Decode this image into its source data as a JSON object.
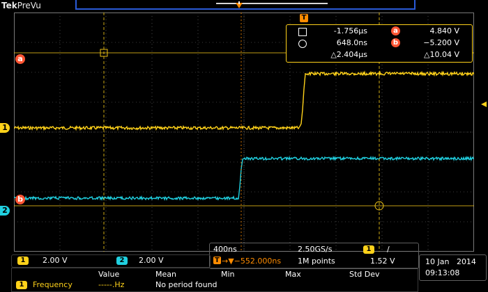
{
  "header": {
    "brand_bold": "Tek",
    "brand_mode": "PreVu"
  },
  "channels": [
    {
      "id": "1",
      "scale": "2.00 V",
      "color": "#ffd21a"
    },
    {
      "id": "2",
      "scale": "2.00 V",
      "color": "#20d0e0"
    }
  ],
  "cursor_labels": {
    "a": "a",
    "b": "b"
  },
  "cursor_readout": {
    "tag": "T",
    "time_a": "-1.756µs",
    "time_b": "648.0ns",
    "time_delta": "△2.404µs",
    "volt_a_badge": "a",
    "volt_a": "4.840 V",
    "volt_b_badge": "b",
    "volt_b": "−5.200 V",
    "volt_delta": "△10.04 V"
  },
  "horizontal": {
    "timebase": "400ns",
    "sample_rate": "2.50GS/s",
    "trigger_channel": "1",
    "trigger_slope": "/",
    "trigger_prefix": "T",
    "trigger_offset": "→▼−552.000ns",
    "record_length": "1M points",
    "trigger_level": "1.52 V"
  },
  "datetime": {
    "date": "10 Jan   2014",
    "time": "09:13:08"
  },
  "measurements": {
    "headers": [
      "Value",
      "Mean",
      "Min",
      "Max",
      "Std Dev"
    ],
    "row": {
      "channel": "1",
      "name": "Frequency",
      "value": "-----.Hz",
      "note": "No period found"
    }
  },
  "colors": {
    "ch1": "#ffd21a",
    "ch2": "#20d0e0",
    "cursor": "#ff5533",
    "grid": "#7a7a7a",
    "trigger": "#ff8c00"
  }
}
